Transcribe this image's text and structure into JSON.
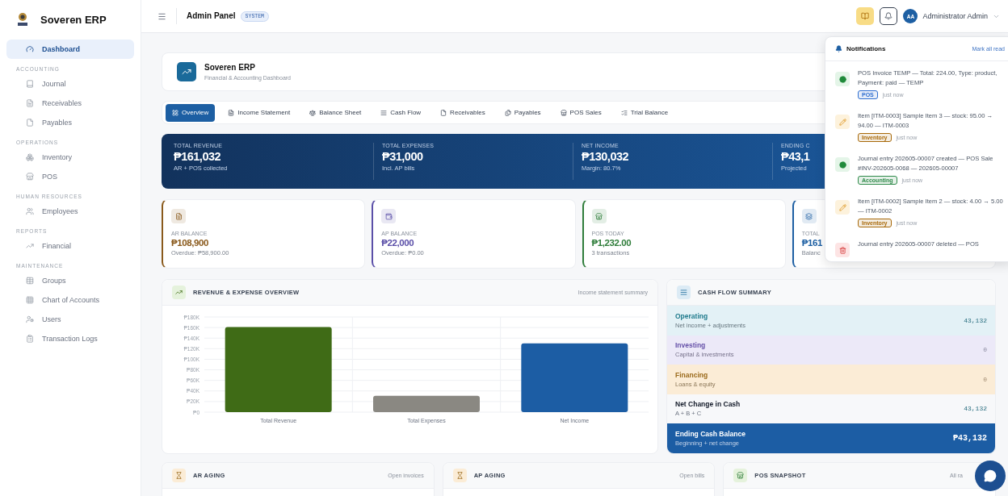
{
  "sidebar": {
    "brand": "Soveren ERP",
    "sections": [
      {
        "items": [
          {
            "label": "Dashboard",
            "selected": true
          }
        ]
      },
      {
        "title": "ACCOUNTING",
        "items": [
          {
            "label": "Journal",
            "selected": false
          },
          {
            "label": "Receivables",
            "selected": false
          },
          {
            "label": "Payables",
            "selected": false
          }
        ]
      },
      {
        "title": "OPERATIONS",
        "items": [
          {
            "label": "Inventory",
            "selected": false
          },
          {
            "label": "POS",
            "selected": false
          }
        ]
      },
      {
        "title": "HUMAN RESOURCES",
        "items": [
          {
            "label": "Employees",
            "selected": false
          }
        ]
      },
      {
        "title": "REPORTS",
        "items": [
          {
            "label": "Financial",
            "selected": false
          }
        ]
      },
      {
        "title": "MAINTENANCE",
        "items": [
          {
            "label": "Groups",
            "selected": false
          },
          {
            "label": "Chart of Accounts",
            "selected": false
          },
          {
            "label": "Users",
            "selected": false
          },
          {
            "label": "Transaction Logs",
            "selected": false
          }
        ]
      }
    ]
  },
  "header": {
    "title": "Admin Panel",
    "badge": "SYSTEM",
    "avatar": "AA",
    "user": "Administrator Admin"
  },
  "page_title": {
    "title": "Soveren ERP",
    "subtitle": "Financial & Accounting Dashboard"
  },
  "tabs": [
    {
      "label": "Overview",
      "selected": true
    },
    {
      "label": "Income Statement",
      "selected": false
    },
    {
      "label": "Balance Sheet",
      "selected": false
    },
    {
      "label": "Cash Flow",
      "selected": false
    },
    {
      "label": "Receivables",
      "selected": false
    },
    {
      "label": "Payables",
      "selected": false
    },
    {
      "label": "POS Sales",
      "selected": false
    },
    {
      "label": "Trial Balance",
      "selected": false
    }
  ],
  "banner": [
    {
      "label": "TOTAL REVENUE",
      "value": "₱161,032",
      "note": "AR + POS collected"
    },
    {
      "label": "TOTAL EXPENSES",
      "value": "₱31,000",
      "note": "Incl. AP bills"
    },
    {
      "label": "NET INCOME",
      "value": "₱130,032",
      "note": "Margin: 80.7%"
    },
    {
      "label": "ENDING C",
      "value": "₱43,1",
      "note": "Projected"
    }
  ],
  "kpis": [
    {
      "label": "AR BALANCE",
      "value": "₱108,900",
      "note": "Overdue: ₱58,900.00",
      "color": "#8a5a1c"
    },
    {
      "label": "AP BALANCE",
      "value": "₱22,000",
      "note": "Overdue: ₱0.00",
      "color": "#5b4fa8"
    },
    {
      "label": "POS TODAY",
      "value": "₱1,232.00",
      "note": "3 transactions",
      "color": "#2f7d3a"
    },
    {
      "label": "TOTAL",
      "value": "₱161",
      "note": "Balanc",
      "color": "#1d5fa3"
    }
  ],
  "revenue_panel": {
    "title": "REVENUE & EXPENSE OVERVIEW",
    "subtitle": "Income statement summary",
    "chart_data": {
      "type": "bar",
      "grid": true,
      "series": [
        {
          "name": "Total Revenue",
          "color": "#3f6b16",
          "values": [
            161000
          ]
        },
        {
          "name": "Total Expenses",
          "color": "#8a8882",
          "values": [
            31000
          ]
        },
        {
          "name": "Net Income",
          "color": "#1c5da4",
          "values": [
            130000
          ]
        }
      ],
      "ylim": [
        0,
        180000
      ],
      "yticks": [
        {
          "value": 0,
          "label": "₱0"
        },
        {
          "value": 20000,
          "label": "₱20K"
        },
        {
          "value": 40000,
          "label": "₱40K"
        },
        {
          "value": 60000,
          "label": "₱60K"
        },
        {
          "value": 80000,
          "label": "₱80K"
        },
        {
          "value": 100000,
          "label": "₱100K"
        },
        {
          "value": 120000,
          "label": "₱120K"
        },
        {
          "value": 140000,
          "label": "₱140K"
        },
        {
          "value": 160000,
          "label": "₱160K"
        },
        {
          "value": 180000,
          "label": "₱180K"
        }
      ]
    }
  },
  "cash_flow": {
    "title": "CASH FLOW SUMMARY",
    "rows": [
      {
        "kind": "operating",
        "label": "Operating",
        "note": "Net income + adjustments",
        "value": "43,132"
      },
      {
        "kind": "investing",
        "label": "Investing",
        "note": "Capital & investments",
        "value": "0"
      },
      {
        "kind": "financing",
        "label": "Financing",
        "note": "Loans & equity",
        "value": "0"
      },
      {
        "kind": "net",
        "label": "Net Change in Cash",
        "note": "A + B + C",
        "value": "43,132"
      },
      {
        "kind": "ending",
        "label": "Ending Cash Balance",
        "note": "Beginning + net change",
        "value": "₱43,132"
      }
    ]
  },
  "bottom_panels": [
    {
      "title": "AR AGING",
      "subtitle": "Open invoices"
    },
    {
      "title": "AP AGING",
      "subtitle": "Open bills"
    },
    {
      "title": "POS SNAPSHOT",
      "subtitle": "All ra"
    }
  ],
  "notifications": {
    "title": "Notifications",
    "action": "Mark all read",
    "items": [
      {
        "kind": "created",
        "text": "POS Invoice TEMP — Total: 224.00, Type: product, Payment: paid — TEMP",
        "tag": "POS",
        "color": "#2f6fd0",
        "time": "just now"
      },
      {
        "kind": "edited",
        "text": "Item [ITM-0003] Sample Item 3 — stock: 95.00 → 94.00 — ITM-0003",
        "tag": "Inventory",
        "color": "#a8690a",
        "time": "just now"
      },
      {
        "kind": "created",
        "text": "Journal entry 202605-00007 created — POS Sale #INV-202605-0068 — 202605-00007",
        "tag": "Accounting",
        "color": "#2f8a4a",
        "time": "just now"
      },
      {
        "kind": "edited",
        "text": "Item [ITM-0002] Sample Item 2 — stock: 4.00 → 5.00 — ITM-0002",
        "tag": "Inventory",
        "color": "#a8690a",
        "time": "just now"
      },
      {
        "kind": "deleted",
        "text": "Journal entry 202605-00007 deleted — POS"
      }
    ]
  }
}
